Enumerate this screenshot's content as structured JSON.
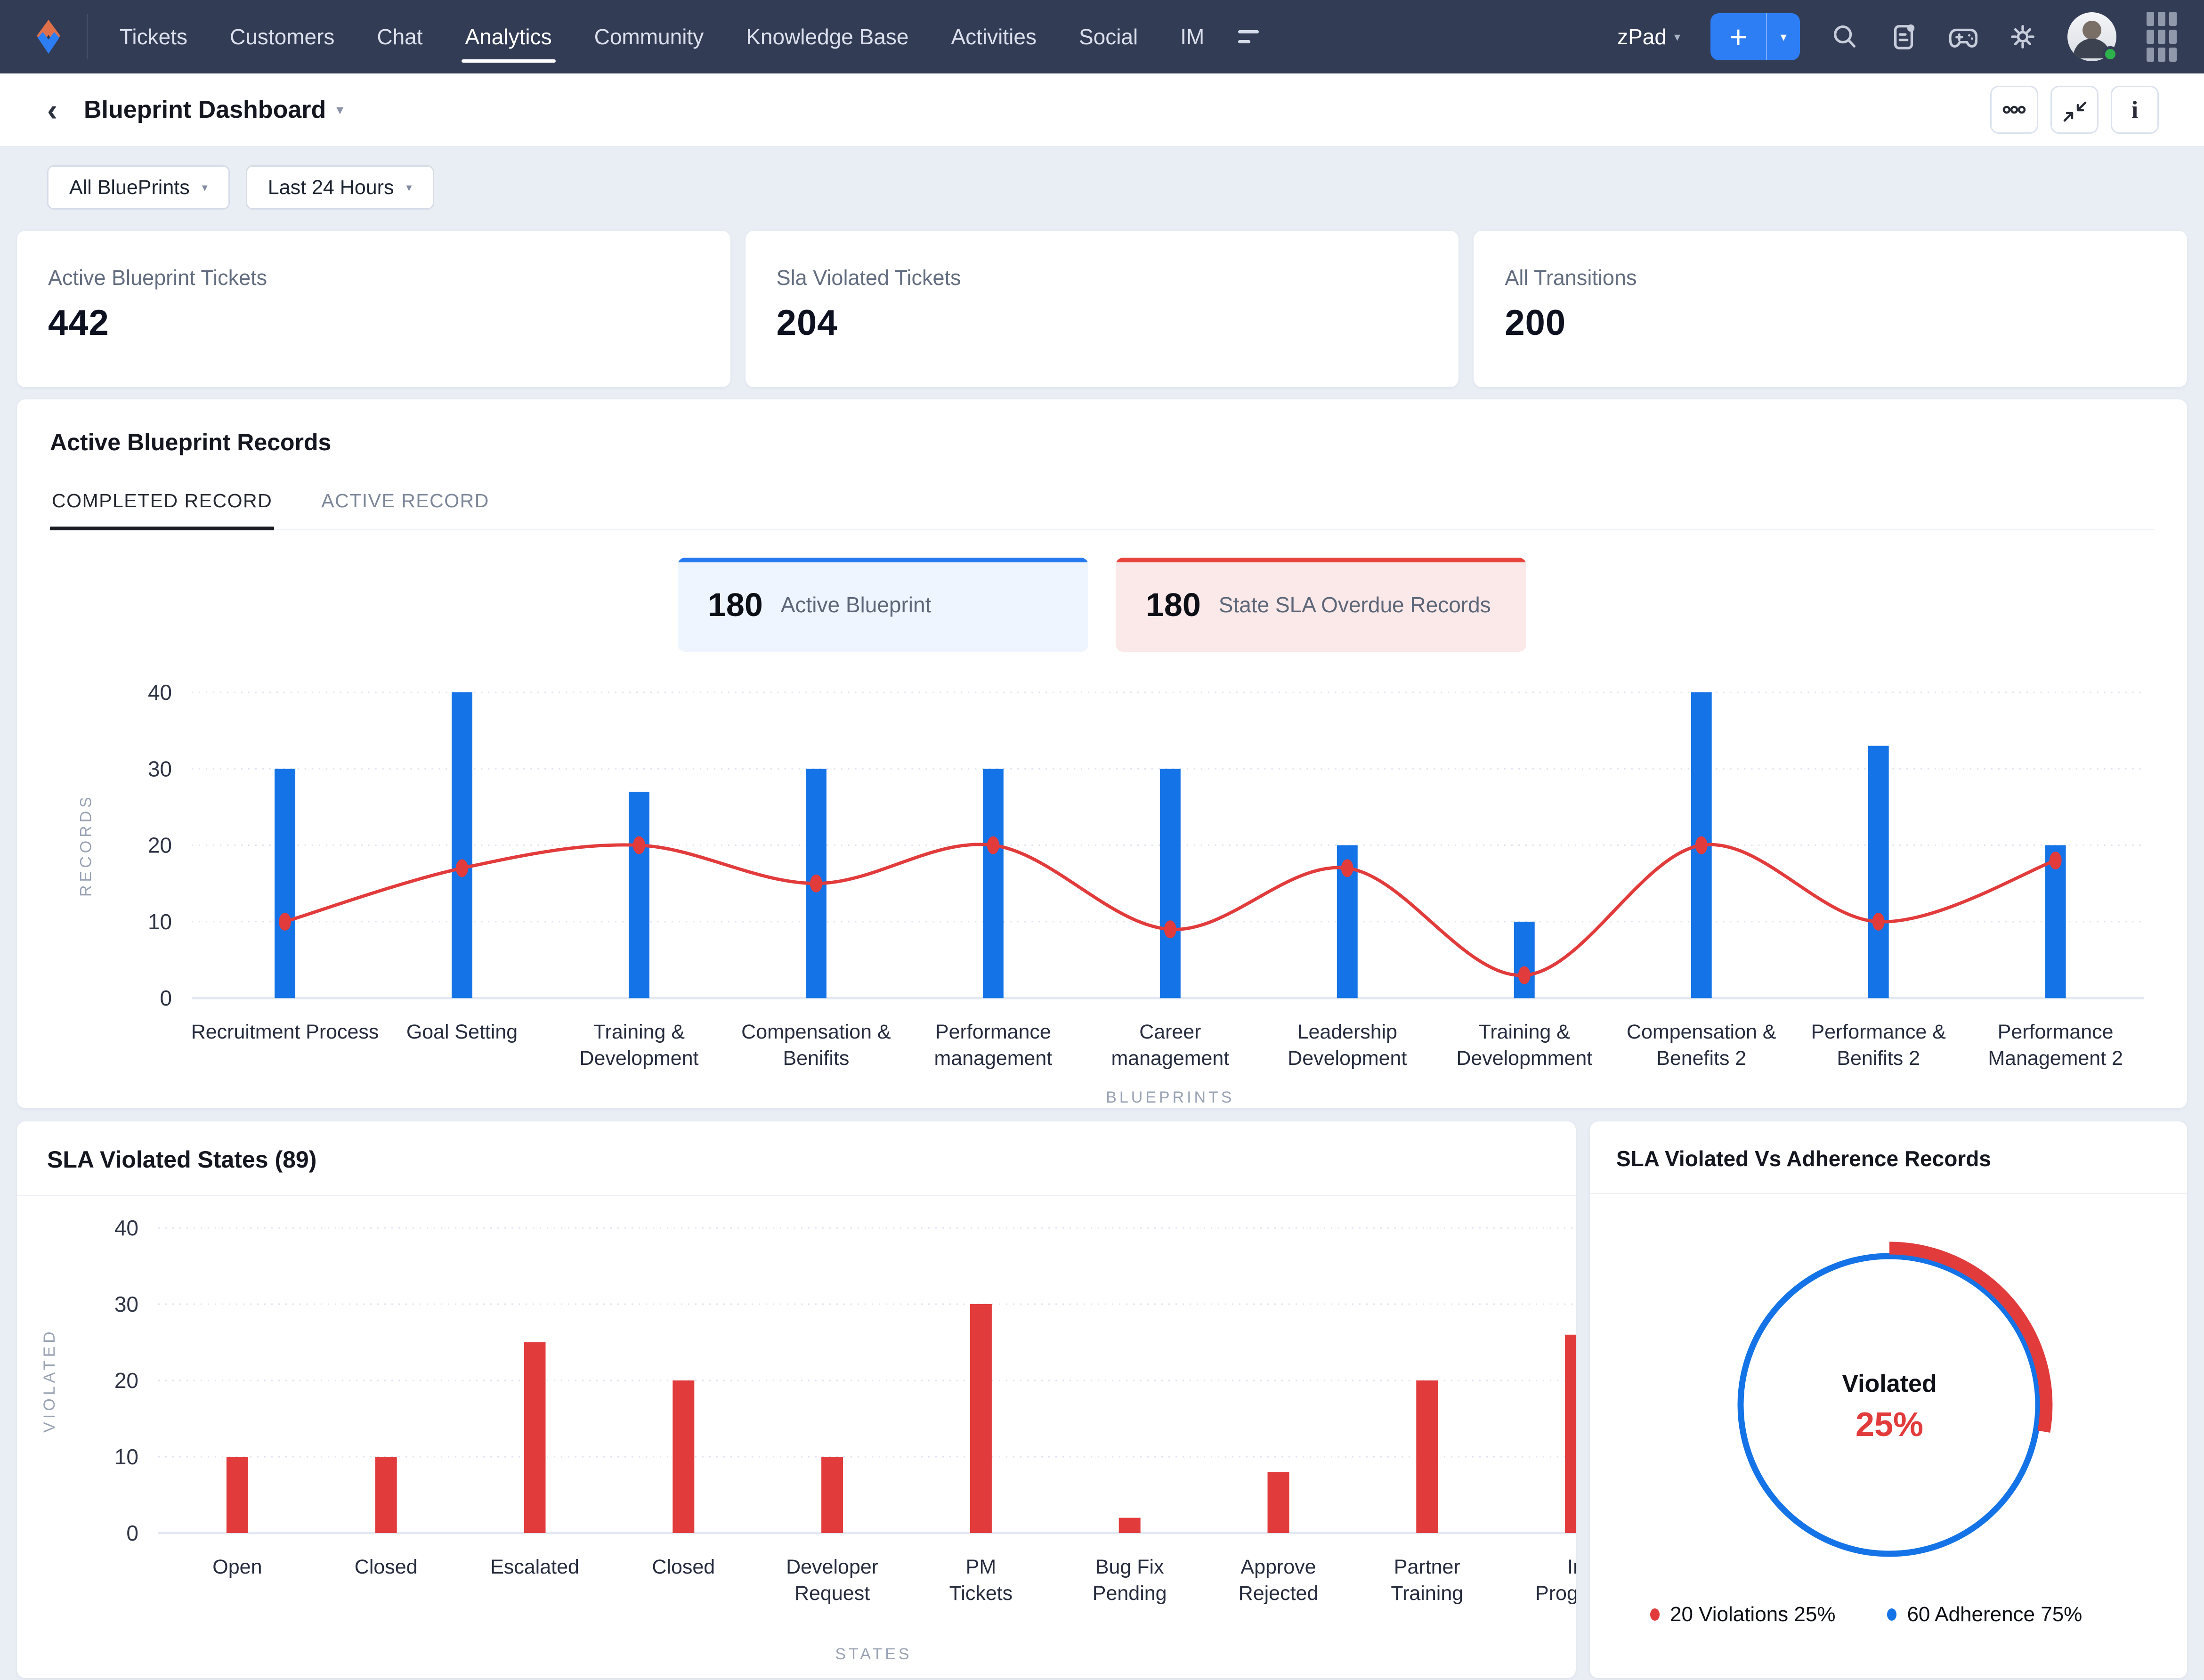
{
  "nav": {
    "items": [
      "Tickets",
      "Customers",
      "Chat",
      "Analytics",
      "Community",
      "Knowledge Base",
      "Activities",
      "Social",
      "IM"
    ],
    "active": "Analytics",
    "portal_label": "zPad",
    "icons": {
      "plus": "+",
      "caret_down": "▾",
      "back": "‹",
      "info": "i"
    }
  },
  "header": {
    "title": "Blueprint Dashboard"
  },
  "filters": {
    "blueprint": "All BluePrints",
    "time_range": "Last 24 Hours"
  },
  "stats": [
    {
      "label": "Active Blueprint Tickets",
      "value": "442"
    },
    {
      "label": "Sla Violated Tickets",
      "value": "204"
    },
    {
      "label": "All Transitions",
      "value": "200"
    }
  ],
  "records": {
    "title": "Active Blueprint Records",
    "tabs": [
      {
        "label": "COMPLETED RECORD",
        "active": true
      },
      {
        "label": "ACTIVE RECORD",
        "active": false
      }
    ],
    "chips": [
      {
        "value": "180",
        "label": "Active Blueprint",
        "accent": "#2479f1",
        "bg": "#eef5fe"
      },
      {
        "value": "180",
        "label": "State SLA Overdue Records",
        "accent": "#e8443b",
        "bg": "#fbe9e9"
      }
    ]
  },
  "chart_data": [
    {
      "id": "blueprint-records-combo",
      "type": "bar",
      "title": "Active Blueprint Records",
      "categories": [
        "Recruitment Process",
        "Goal Setting",
        "Training & Development",
        "Compensation & Benifits",
        "Performance management",
        "Career management",
        "Leadership Development",
        "Training & Developmment",
        "Compensation & Benefits 2",
        "Performance & Benifits 2",
        "Performance Management 2"
      ],
      "category_lines": [
        [
          "Recruitment Process"
        ],
        [
          "Goal Setting"
        ],
        [
          "Training &",
          "Development"
        ],
        [
          "Compensation &",
          "Benifits"
        ],
        [
          "Performance",
          "management"
        ],
        [
          "Career",
          "management"
        ],
        [
          "Leadership",
          "Development"
        ],
        [
          "Training &",
          "Developmment"
        ],
        [
          "Compensation &",
          "Benefits 2"
        ],
        [
          "Performance &",
          "Benifits 2"
        ],
        [
          "Performance",
          "Management 2"
        ]
      ],
      "series": [
        {
          "name": "Completed Records",
          "type": "bar",
          "color": "#1473e6",
          "values": [
            30,
            40,
            27,
            30,
            30,
            30,
            20,
            10,
            40,
            33,
            20
          ]
        },
        {
          "name": "State SLA Overdue",
          "type": "line",
          "color": "#e23b3c",
          "values": [
            10,
            17,
            20,
            15,
            20,
            9,
            17,
            3,
            20,
            10,
            18
          ]
        }
      ],
      "xlabel": "BLUEPRINTS",
      "ylabel": "RECORDS",
      "ylim": [
        0,
        40
      ],
      "yticks": [
        0,
        10,
        20,
        30,
        40
      ],
      "grid": true,
      "legend_position": "none"
    },
    {
      "id": "sla-violated-states",
      "type": "bar",
      "title": "SLA Violated States (89)",
      "categories": [
        "Open",
        "Closed",
        "Escalated",
        "Closed",
        "Developer Request",
        "PM Tickets",
        "Bug Fix Pending",
        "Approve Rejected",
        "Partner Training",
        "In Progress"
      ],
      "category_lines": [
        [
          "Open"
        ],
        [
          "Closed"
        ],
        [
          "Escalated"
        ],
        [
          "Closed"
        ],
        [
          "Developer",
          "Request"
        ],
        [
          "PM",
          "Tickets"
        ],
        [
          "Bug Fix",
          "Pending"
        ],
        [
          "Approve",
          "Rejected"
        ],
        [
          "Partner",
          "Training"
        ],
        [
          "In",
          "Progress"
        ]
      ],
      "values": [
        10,
        10,
        25,
        20,
        10,
        30,
        2,
        8,
        20,
        26
      ],
      "color": "#e23b3c",
      "xlabel": "STATES",
      "ylabel": "VIOLATED",
      "ylim": [
        0,
        40
      ],
      "yticks": [
        0,
        10,
        20,
        30,
        40
      ],
      "grid": true
    },
    {
      "id": "sla-violated-vs-adherence",
      "type": "pie",
      "donut": true,
      "title": "SLA Violated Vs Adherence Records",
      "slices": [
        {
          "label": "Violations",
          "value": 20,
          "pct": "25%",
          "color": "#e23b3c"
        },
        {
          "label": "Adherence",
          "value": 60,
          "pct": "75%",
          "color": "#1473e6"
        }
      ],
      "center_label": "Violated",
      "center_value": "25%",
      "legend": [
        {
          "text": "20 Violations 25%",
          "color": "#e23b3c"
        },
        {
          "text": "60 Adherence 75%",
          "color": "#1473e6"
        }
      ],
      "legend_position": "bottom"
    }
  ],
  "colors": {
    "nav_bg": "#333c55",
    "accent_blue": "#1473e6",
    "accent_red": "#e23b3c",
    "page_bg": "#e9edf4"
  }
}
